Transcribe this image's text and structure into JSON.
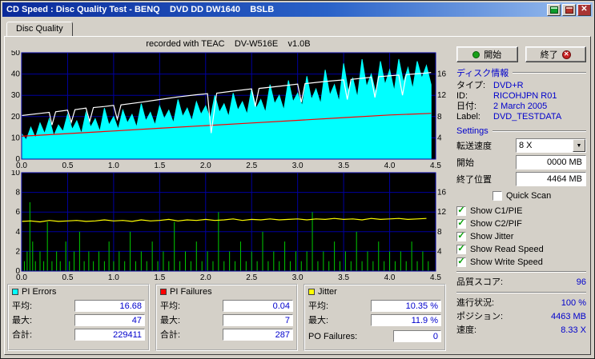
{
  "window": {
    "title": "CD Speed : Disc Quality Test - BENQ    DVD DD DW1640    BSLB"
  },
  "tab": {
    "label": "Disc Quality"
  },
  "chart_header": {
    "text": "recorded with TEAC    DV-W516E    v1.0B"
  },
  "icons": {
    "close": "✕",
    "dropdown": "▼",
    "check": "✓",
    "exit_x": "✕"
  },
  "buttons": {
    "start_label": "開始",
    "exit_label": "終了"
  },
  "disc_info": {
    "header": "ディスク情報",
    "rows": [
      {
        "label": "タイプ:",
        "value": "DVD+R"
      },
      {
        "label": "ID:",
        "value": "RICOHJPN R01"
      },
      {
        "label": "日付:",
        "value": "2 March 2005"
      },
      {
        "label": "Label:",
        "value": "DVD_TESTDATA"
      }
    ]
  },
  "settings": {
    "header": "Settings",
    "speed_label": "転送速度",
    "speed_value": "8 X",
    "start_label": "開始",
    "start_value": "0000 MB",
    "end_label": "終了位置",
    "end_value": "4464 MB",
    "checkboxes": [
      {
        "label": "Quick Scan",
        "checked": false
      },
      {
        "label": "Show C1/PIE",
        "checked": true
      },
      {
        "label": "Show C2/PIF",
        "checked": true
      },
      {
        "label": "Show Jitter",
        "checked": true
      },
      {
        "label": "Show Read Speed",
        "checked": true
      },
      {
        "label": "Show Write Speed",
        "checked": true
      }
    ]
  },
  "score": {
    "label": "品質スコア:",
    "value": "96"
  },
  "progress": [
    {
      "label": "進行状況:",
      "value": "100 %"
    },
    {
      "label": "ポジション:",
      "value": "4463 MB"
    },
    {
      "label": "速度:",
      "value": "8.33 X"
    }
  ],
  "stats": [
    {
      "title": "PI Errors",
      "legend_color": "#00ffff",
      "rows": [
        {
          "label": "平均:",
          "value": "16.68"
        },
        {
          "label": "最大:",
          "value": "47"
        },
        {
          "label": "合計:",
          "value": "229411"
        }
      ]
    },
    {
      "title": "PI Failures",
      "legend_color": "#ff0000",
      "rows": [
        {
          "label": "平均:",
          "value": "0.04"
        },
        {
          "label": "最大:",
          "value": "7"
        },
        {
          "label": "合計:",
          "value": "287"
        }
      ]
    },
    {
      "title": "Jitter",
      "legend_color": "#ffff00",
      "rows": [
        {
          "label": "平均:",
          "value": "10.35 %"
        },
        {
          "label": "最大:",
          "value": "11.9 %"
        }
      ],
      "extra": {
        "label": "PO Failures:",
        "value": "0"
      }
    }
  ],
  "chart_data": [
    {
      "type": "area",
      "title": "PI Errors with Read/Write Speed",
      "bg": "#000000",
      "grid_color": "#0000a0",
      "x_axis": {
        "range": [
          0,
          4.5
        ],
        "ticks": [
          0,
          0.5,
          1,
          1.5,
          2,
          2.5,
          3,
          3.5,
          4,
          4.5
        ],
        "tick_labels": [
          "0.0",
          "0.5",
          "1.0",
          "1.5",
          "2.0",
          "2.5",
          "3.0",
          "3.5",
          "4.0",
          "4.5"
        ]
      },
      "left_axis": {
        "range": [
          0,
          50
        ],
        "ticks": [
          0,
          10,
          20,
          30,
          40,
          50
        ]
      },
      "right_axis": {
        "range": [
          0,
          20
        ],
        "ticks": [
          4,
          8,
          12,
          16
        ]
      },
      "series": [
        {
          "name": "PI Errors",
          "type": "area",
          "color": "#00ffff",
          "axis": "left",
          "x_start": 0,
          "x_step": 0.05,
          "values": [
            12,
            9,
            15,
            10,
            17,
            12,
            19,
            11,
            16,
            13,
            21,
            14,
            18,
            12,
            22,
            15,
            19,
            13,
            24,
            16,
            20,
            14,
            23,
            17,
            21,
            15,
            26,
            18,
            22,
            16,
            25,
            19,
            23,
            17,
            28,
            20,
            24,
            18,
            27,
            21,
            25,
            19,
            30,
            22,
            26,
            20,
            31,
            23,
            27,
            21,
            33,
            24,
            28,
            22,
            35,
            26,
            30,
            23,
            37,
            27,
            31,
            25,
            39,
            28,
            33,
            26,
            42,
            30,
            35,
            27,
            45,
            32,
            38,
            29,
            47,
            34,
            40,
            31,
            46,
            35,
            42,
            32,
            47,
            36,
            43,
            33,
            46,
            38,
            44,
            35
          ]
        },
        {
          "name": "Write Speed",
          "type": "line",
          "color": "#ff0000",
          "axis": "right",
          "points": [
            [
              0,
              4.3
            ],
            [
              0.5,
              4.8
            ],
            [
              1.0,
              5.3
            ],
            [
              1.5,
              5.8
            ],
            [
              2.0,
              6.3
            ],
            [
              2.5,
              6.8
            ],
            [
              3.0,
              7.3
            ],
            [
              3.5,
              7.8
            ],
            [
              4.0,
              8.3
            ],
            [
              4.45,
              8.6
            ]
          ]
        },
        {
          "name": "Read Speed",
          "type": "line",
          "color": "#ffffff",
          "axis": "right",
          "points": [
            [
              0,
              8.2
            ],
            [
              0.2,
              8.6
            ],
            [
              0.3,
              8.8
            ],
            [
              0.33,
              6.4
            ],
            [
              0.37,
              8.9
            ],
            [
              0.5,
              9.2
            ],
            [
              0.54,
              6.9
            ],
            [
              0.58,
              9.3
            ],
            [
              0.7,
              9.6
            ],
            [
              0.74,
              7.1
            ],
            [
              0.78,
              9.7
            ],
            [
              0.9,
              9.9
            ],
            [
              1.0,
              10.1
            ],
            [
              1.04,
              7.5
            ],
            [
              1.08,
              10.2
            ],
            [
              1.3,
              10.7
            ],
            [
              1.5,
              11.2
            ],
            [
              1.7,
              11.7
            ],
            [
              1.9,
              12.1
            ],
            [
              2.02,
              12.3
            ],
            [
              2.06,
              4.9
            ],
            [
              2.12,
              12.4
            ],
            [
              2.3,
              12.8
            ],
            [
              2.5,
              13.2
            ],
            [
              2.54,
              9.9
            ],
            [
              2.58,
              13.3
            ],
            [
              2.8,
              13.7
            ],
            [
              3.0,
              14.1
            ],
            [
              3.04,
              10.7
            ],
            [
              3.08,
              14.2
            ],
            [
              3.3,
              14.6
            ],
            [
              3.5,
              14.9
            ],
            [
              3.54,
              11.2
            ],
            [
              3.58,
              15.0
            ],
            [
              3.8,
              15.4
            ],
            [
              3.84,
              11.6
            ],
            [
              3.88,
              15.5
            ],
            [
              4.1,
              15.8
            ],
            [
              4.14,
              12.0
            ],
            [
              4.18,
              15.9
            ],
            [
              4.4,
              16.2
            ],
            [
              4.45,
              16.3
            ]
          ]
        }
      ]
    },
    {
      "type": "bar",
      "title": "PI Failures with Jitter",
      "bg": "#000000",
      "grid_color": "#0000a0",
      "x_axis": {
        "range": [
          0,
          4.5
        ],
        "ticks": [
          0,
          0.5,
          1,
          1.5,
          2,
          2.5,
          3,
          3.5,
          4,
          4.5
        ],
        "tick_labels": [
          "0.0",
          "0.5",
          "1.0",
          "1.5",
          "2.0",
          "2.5",
          "3.0",
          "3.5",
          "4.0",
          "4.5"
        ]
      },
      "left_axis": {
        "range": [
          0,
          10
        ],
        "ticks": [
          0,
          2,
          4,
          6,
          8,
          10
        ]
      },
      "right_axis": {
        "range": [
          0,
          20
        ],
        "ticks": [
          4,
          8,
          12,
          16
        ]
      },
      "series": [
        {
          "name": "PI Failures",
          "type": "bars",
          "color": "#00cc00",
          "axis": "left",
          "points": [
            [
              0.03,
              1
            ],
            [
              0.06,
              2
            ],
            [
              0.09,
              7
            ],
            [
              0.12,
              3
            ],
            [
              0.15,
              1
            ],
            [
              0.2,
              2
            ],
            [
              0.24,
              1
            ],
            [
              0.28,
              5
            ],
            [
              0.33,
              1
            ],
            [
              0.38,
              2
            ],
            [
              0.42,
              1
            ],
            [
              0.48,
              3
            ],
            [
              0.52,
              1
            ],
            [
              0.57,
              2
            ],
            [
              0.63,
              4
            ],
            [
              0.68,
              1
            ],
            [
              0.73,
              2
            ],
            [
              0.78,
              1
            ],
            [
              0.84,
              2
            ],
            [
              0.9,
              1
            ],
            [
              0.95,
              3
            ],
            [
              1.0,
              1
            ],
            [
              1.06,
              2
            ],
            [
              1.12,
              1
            ],
            [
              1.18,
              4
            ],
            [
              1.24,
              1
            ],
            [
              1.3,
              2
            ],
            [
              1.36,
              1
            ],
            [
              1.42,
              3
            ],
            [
              1.48,
              1
            ],
            [
              1.54,
              2
            ],
            [
              1.6,
              1
            ],
            [
              1.66,
              5
            ],
            [
              1.72,
              1
            ],
            [
              1.78,
              2
            ],
            [
              1.84,
              1
            ],
            [
              1.9,
              3
            ],
            [
              1.96,
              1
            ],
            [
              2.02,
              2
            ],
            [
              2.08,
              1
            ],
            [
              2.14,
              6
            ],
            [
              2.2,
              1
            ],
            [
              2.26,
              2
            ],
            [
              2.32,
              1
            ],
            [
              2.38,
              3
            ],
            [
              2.44,
              1
            ],
            [
              2.5,
              2
            ],
            [
              2.56,
              1
            ],
            [
              2.62,
              4
            ],
            [
              2.68,
              1
            ],
            [
              2.74,
              2
            ],
            [
              2.8,
              1
            ],
            [
              2.86,
              3
            ],
            [
              2.92,
              1
            ],
            [
              2.98,
              2
            ],
            [
              3.04,
              1
            ],
            [
              3.1,
              2
            ],
            [
              3.16,
              6
            ],
            [
              3.22,
              1
            ],
            [
              3.28,
              2
            ],
            [
              3.34,
              1
            ],
            [
              3.4,
              3
            ],
            [
              3.46,
              1
            ],
            [
              3.52,
              2
            ],
            [
              3.58,
              1
            ],
            [
              3.64,
              4
            ],
            [
              3.7,
              1
            ],
            [
              3.76,
              2
            ],
            [
              3.82,
              1
            ],
            [
              3.88,
              3
            ],
            [
              3.94,
              1
            ],
            [
              4.0,
              2
            ],
            [
              4.06,
              1
            ],
            [
              4.12,
              2
            ],
            [
              4.18,
              1
            ],
            [
              4.24,
              3
            ],
            [
              4.3,
              1
            ],
            [
              4.36,
              2
            ],
            [
              4.42,
              1
            ]
          ]
        },
        {
          "name": "Jitter",
          "type": "line",
          "color": "#ffff00",
          "axis": "right",
          "x_start": 0,
          "x_step": 0.1,
          "values": [
            10.1,
            10.2,
            10.0,
            10.3,
            10.1,
            10.2,
            10.3,
            10.1,
            10.2,
            10.4,
            10.2,
            10.3,
            10.1,
            10.4,
            10.2,
            10.3,
            10.5,
            10.2,
            10.4,
            10.3,
            10.5,
            10.3,
            10.4,
            10.6,
            10.3,
            10.5,
            10.4,
            10.6,
            10.4,
            10.5,
            10.6,
            10.4,
            10.6,
            10.5,
            10.7,
            10.5,
            10.6,
            10.4,
            10.7,
            10.5,
            10.6,
            10.7,
            10.5,
            10.6,
            10.7
          ]
        }
      ]
    }
  ]
}
